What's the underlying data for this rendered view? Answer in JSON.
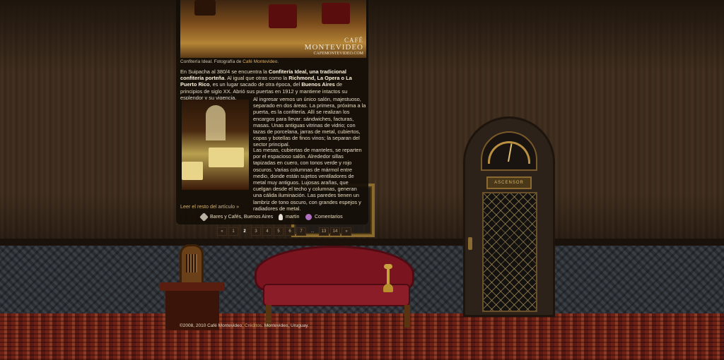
{
  "photo": {
    "brand_line1": "CAFÉ",
    "brand_line2": "MONTEVIDEO",
    "brand_line3": "CAFEMONTEVIDEO.COM",
    "caption_text": "Confitería Ideal. Fotografía de ",
    "caption_link": "Café Montevideo."
  },
  "article": {
    "p1_a": "En Suipacha al 380/4 se encuentra la ",
    "p1_b": "Confitería Ideal, una tradicional confitería porteña",
    "p1_c": ". Al igual que otras como la ",
    "p1_d": "Richmond, La Opera o La Puerto Rico",
    "p1_e": ", es un lugar sacado de otra época, del ",
    "p1_f": "Buenos Aires",
    "p1_g": " de principios de siglo XX. Abrió sus puertas en 1912 y mantiene intactos su esplendor y su vigencia.",
    "p2": "Al ingresar vemos un único salón, majestuoso, separado en dos áreas. La primera, próxima a la puerta, es la confitería. Allí se realizan los encargos para llevar: sándwiches, facturas, masas. Unas antiguas vitrinas de vidrio; con tazas de porcelana, jarras de metal, cubiertos, copas y botellas de finos vinos; la separan del sector principal.",
    "p3": "Las mesas, cubiertas de manteles, se reparten por el espacioso salón. Alrededor sillas tapizadas en cuero, con tonos verde y rojo oscuros. Varias columnas de mármol entre medio, donde están sujetos ventiladores de metal muy antiguos. Lujosas arañas, que cuelgan desde el techo y columnas, generan una cálida iluminación. Las paredes tienen un lambriz de tono oscuro, con grandes espejos y radiadores de metal.",
    "read_more": "Leer el resto del artículo »"
  },
  "meta": {
    "category": "Bares y Cafés, Buenos Aires",
    "author": "martin",
    "comments": "Comentarios",
    "tag_icon_color": "#b8b0a0",
    "author_icon_color": "#e6e0d8",
    "comment_icon_color": "#b070c0"
  },
  "pagination": {
    "prev": "«",
    "pages": [
      "1",
      "2",
      "3",
      "4",
      "5",
      "6",
      "7"
    ],
    "current": "2",
    "ellipsis": "...",
    "last_pages": [
      "13",
      "14"
    ],
    "next": "»"
  },
  "elevator": {
    "plate_text": "ASCENSOR"
  },
  "footer": {
    "text_a": "©2008, 2010 Café Montevideo. ",
    "link": "Créditos",
    "text_b": ". Montevideo, Uruguay."
  },
  "colors": {
    "link": "#d9b26a",
    "panel": "#140e08",
    "text": "#e6dac2"
  }
}
